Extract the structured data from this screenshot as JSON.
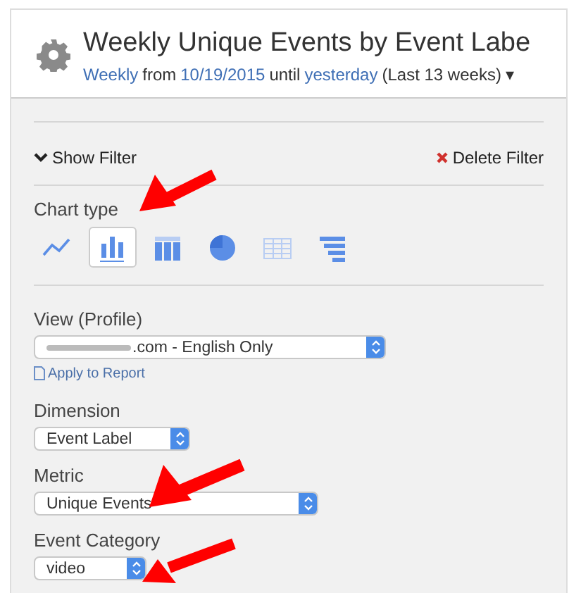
{
  "header": {
    "title": "Weekly Unique Events by Event Labe",
    "subtitle": {
      "interval": "Weekly",
      "from_word": "from",
      "start_date": "10/19/2015",
      "until_word": "until",
      "end_date": "yesterday",
      "range": "(Last 13 weeks)",
      "caret": "▾"
    }
  },
  "filter": {
    "show_label": "Show Filter",
    "delete_label": "Delete Filter"
  },
  "chart_type": {
    "label": "Chart type",
    "options": [
      {
        "kind": "line",
        "selected": false
      },
      {
        "kind": "column",
        "selected": true
      },
      {
        "kind": "stacked",
        "selected": false
      },
      {
        "kind": "pie",
        "selected": false
      },
      {
        "kind": "table",
        "selected": false
      },
      {
        "kind": "funnel",
        "selected": false
      }
    ]
  },
  "fields": [
    {
      "label": "View (Profile)",
      "value": ".com - English Only",
      "redacted": true,
      "link": "Apply to Report"
    },
    {
      "label": "Dimension",
      "value": "Event Label",
      "redacted": false
    },
    {
      "label": "Metric",
      "value": "Unique Events",
      "redacted": false
    },
    {
      "label": "Event Category",
      "value": "video",
      "redacted": false
    }
  ]
}
